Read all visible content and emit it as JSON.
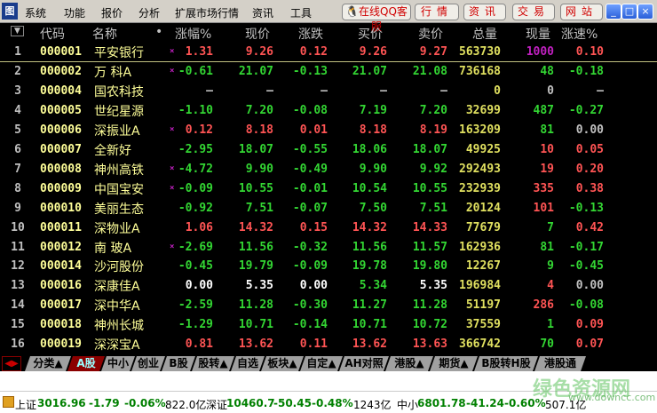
{
  "menu": {
    "logo": "图",
    "items": [
      "系统",
      "功能",
      "报价",
      "分析",
      "扩展市场行情",
      "资讯",
      "工具"
    ],
    "qq": "在线QQ客服",
    "buttons": [
      "行情",
      "资讯",
      "交易",
      "网站"
    ],
    "window": [
      "_",
      "□",
      "×"
    ]
  },
  "header": {
    "dropdown": "▼",
    "cols": [
      "代码",
      "名称",
      "•",
      "涨幅%",
      "现价",
      "涨跌",
      "买价",
      "卖价",
      "总量",
      "现量",
      "涨速%"
    ]
  },
  "rows": [
    [
      "1",
      "000001",
      "平安银行",
      "×",
      [
        "1.31",
        "r"
      ],
      [
        "9.26",
        "r"
      ],
      [
        "0.12",
        "r"
      ],
      [
        "9.26",
        "r"
      ],
      [
        "9.27",
        "r"
      ],
      [
        "563730",
        "y"
      ],
      [
        "1000",
        "m"
      ],
      [
        "0.10",
        "r"
      ]
    ],
    [
      "2",
      "000002",
      "万 科A",
      "×",
      [
        "-0.61",
        "g"
      ],
      [
        "21.07",
        "g"
      ],
      [
        "-0.13",
        "g"
      ],
      [
        "21.07",
        "g"
      ],
      [
        "21.08",
        "g"
      ],
      [
        "736168",
        "y"
      ],
      [
        "48",
        "g"
      ],
      [
        "-0.18",
        "g"
      ]
    ],
    [
      "3",
      "000004",
      "国农科技",
      "",
      [
        "—",
        "s"
      ],
      [
        "—",
        "s"
      ],
      [
        "—",
        "s"
      ],
      [
        "—",
        "s"
      ],
      [
        "—",
        "s"
      ],
      [
        "0",
        "y"
      ],
      [
        "0",
        "s"
      ],
      [
        "—",
        "s"
      ]
    ],
    [
      "4",
      "000005",
      "世纪星源",
      "",
      [
        "-1.10",
        "g"
      ],
      [
        "7.20",
        "g"
      ],
      [
        "-0.08",
        "g"
      ],
      [
        "7.19",
        "g"
      ],
      [
        "7.20",
        "g"
      ],
      [
        "32699",
        "y"
      ],
      [
        "487",
        "g"
      ],
      [
        "-0.27",
        "g"
      ]
    ],
    [
      "5",
      "000006",
      "深振业A",
      "×",
      [
        "0.12",
        "r"
      ],
      [
        "8.18",
        "r"
      ],
      [
        "0.01",
        "r"
      ],
      [
        "8.18",
        "r"
      ],
      [
        "8.19",
        "r"
      ],
      [
        "163209",
        "y"
      ],
      [
        "81",
        "g"
      ],
      [
        "0.00",
        "s"
      ]
    ],
    [
      "6",
      "000007",
      "全新好",
      "",
      [
        "-2.95",
        "g"
      ],
      [
        "18.07",
        "g"
      ],
      [
        "-0.55",
        "g"
      ],
      [
        "18.06",
        "g"
      ],
      [
        "18.07",
        "g"
      ],
      [
        "49925",
        "y"
      ],
      [
        "10",
        "r"
      ],
      [
        "0.05",
        "r"
      ]
    ],
    [
      "7",
      "000008",
      "神州高铁",
      "×",
      [
        "-4.72",
        "g"
      ],
      [
        "9.90",
        "g"
      ],
      [
        "-0.49",
        "g"
      ],
      [
        "9.90",
        "g"
      ],
      [
        "9.92",
        "g"
      ],
      [
        "292493",
        "y"
      ],
      [
        "19",
        "r"
      ],
      [
        "0.20",
        "r"
      ]
    ],
    [
      "8",
      "000009",
      "中国宝安",
      "×",
      [
        "-0.09",
        "g"
      ],
      [
        "10.55",
        "g"
      ],
      [
        "-0.01",
        "g"
      ],
      [
        "10.54",
        "g"
      ],
      [
        "10.55",
        "g"
      ],
      [
        "232939",
        "y"
      ],
      [
        "335",
        "r"
      ],
      [
        "0.38",
        "r"
      ]
    ],
    [
      "9",
      "000010",
      "美丽生态",
      "",
      [
        "-0.92",
        "g"
      ],
      [
        "7.51",
        "g"
      ],
      [
        "-0.07",
        "g"
      ],
      [
        "7.50",
        "g"
      ],
      [
        "7.51",
        "g"
      ],
      [
        "20124",
        "y"
      ],
      [
        "101",
        "r"
      ],
      [
        "-0.13",
        "g"
      ]
    ],
    [
      "10",
      "000011",
      "深物业A",
      "",
      [
        "1.06",
        "r"
      ],
      [
        "14.32",
        "r"
      ],
      [
        "0.15",
        "r"
      ],
      [
        "14.32",
        "r"
      ],
      [
        "14.33",
        "r"
      ],
      [
        "77679",
        "y"
      ],
      [
        "7",
        "g"
      ],
      [
        "0.42",
        "r"
      ]
    ],
    [
      "11",
      "000012",
      "南 玻A",
      "×",
      [
        "-2.69",
        "g"
      ],
      [
        "11.56",
        "g"
      ],
      [
        "-0.32",
        "g"
      ],
      [
        "11.56",
        "g"
      ],
      [
        "11.57",
        "g"
      ],
      [
        "162936",
        "y"
      ],
      [
        "81",
        "g"
      ],
      [
        "-0.17",
        "g"
      ]
    ],
    [
      "12",
      "000014",
      "沙河股份",
      "",
      [
        "-0.45",
        "g"
      ],
      [
        "19.79",
        "g"
      ],
      [
        "-0.09",
        "g"
      ],
      [
        "19.78",
        "g"
      ],
      [
        "19.80",
        "g"
      ],
      [
        "12267",
        "y"
      ],
      [
        "9",
        "g"
      ],
      [
        "-0.45",
        "g"
      ]
    ],
    [
      "13",
      "000016",
      "深康佳A",
      "",
      [
        "0.00",
        "w"
      ],
      [
        "5.35",
        "w"
      ],
      [
        "0.00",
        "w"
      ],
      [
        "5.34",
        "g"
      ],
      [
        "5.35",
        "w"
      ],
      [
        "196984",
        "y"
      ],
      [
        "4",
        "r"
      ],
      [
        "0.00",
        "s"
      ]
    ],
    [
      "14",
      "000017",
      "深中华A",
      "",
      [
        "-2.59",
        "g"
      ],
      [
        "11.28",
        "g"
      ],
      [
        "-0.30",
        "g"
      ],
      [
        "11.27",
        "g"
      ],
      [
        "11.28",
        "g"
      ],
      [
        "51197",
        "y"
      ],
      [
        "286",
        "r"
      ],
      [
        "-0.08",
        "g"
      ]
    ],
    [
      "15",
      "000018",
      "神州长城",
      "",
      [
        "-1.29",
        "g"
      ],
      [
        "10.71",
        "g"
      ],
      [
        "-0.14",
        "g"
      ],
      [
        "10.71",
        "g"
      ],
      [
        "10.72",
        "g"
      ],
      [
        "37559",
        "y"
      ],
      [
        "1",
        "g"
      ],
      [
        "0.09",
        "r"
      ]
    ],
    [
      "16",
      "000019",
      "深深宝A",
      "",
      [
        "0.81",
        "r"
      ],
      [
        "13.62",
        "r"
      ],
      [
        "0.11",
        "r"
      ],
      [
        "13.62",
        "r"
      ],
      [
        "13.63",
        "r"
      ],
      [
        "366742",
        "y"
      ],
      [
        "70",
        "g"
      ],
      [
        "0.07",
        "r"
      ]
    ]
  ],
  "tabs": {
    "arrows": "◀▶",
    "items": [
      "分类▲",
      "A股",
      "中小",
      "创业",
      "B股",
      "股转▲",
      "自选",
      "板块▲",
      "自定▲",
      "AH对照",
      "港股▲",
      "期货▲",
      "B股转H股",
      "港股通"
    ],
    "active": 1
  },
  "status": [
    [
      "上证",
      "sk"
    ],
    [
      "3016.96",
      "sg"
    ],
    [
      "-1.79",
      "sg"
    ],
    [
      "-0.06%",
      "sg"
    ],
    [
      "822.0亿",
      "sk"
    ],
    [
      "深证",
      "sk"
    ],
    [
      "10460.7",
      "sg"
    ],
    [
      "-50.45",
      "sg"
    ],
    [
      "-0.48%",
      "sg"
    ],
    [
      "1243亿",
      "sk"
    ],
    [
      "中小",
      "sk"
    ],
    [
      "6801.78",
      "sg"
    ],
    [
      "-41.24",
      "sg"
    ],
    [
      "-0.60%",
      "sg"
    ],
    [
      "507.1亿",
      "sk"
    ]
  ],
  "watermark": {
    "title": "绿色资源网",
    "url": "www.downcc.com"
  }
}
